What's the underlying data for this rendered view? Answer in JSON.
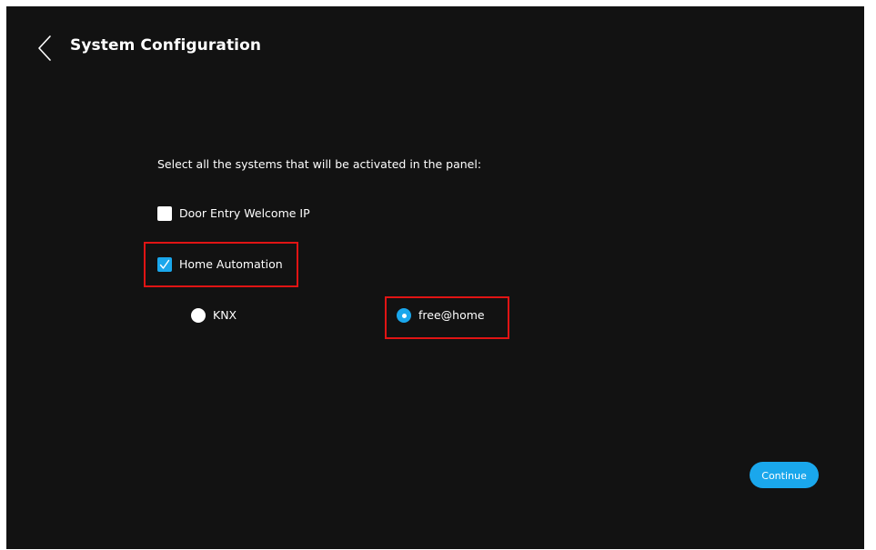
{
  "header": {
    "back_icon": "chevron-left-icon",
    "title": "System Configuration"
  },
  "main": {
    "prompt": "Select all the systems that will be activated in the panel:",
    "options": [
      {
        "label": "Door Entry Welcome IP",
        "checked": false
      },
      {
        "label": "Home Automation",
        "checked": true
      }
    ],
    "sub_options": [
      {
        "label": "KNX",
        "selected": false
      },
      {
        "label": "free@home",
        "selected": true
      }
    ]
  },
  "footer": {
    "continue_label": "Continue"
  },
  "colors": {
    "background": "#121212",
    "accent": "#1aa7ec",
    "highlight": "#e01414",
    "text": "#ffffff"
  }
}
